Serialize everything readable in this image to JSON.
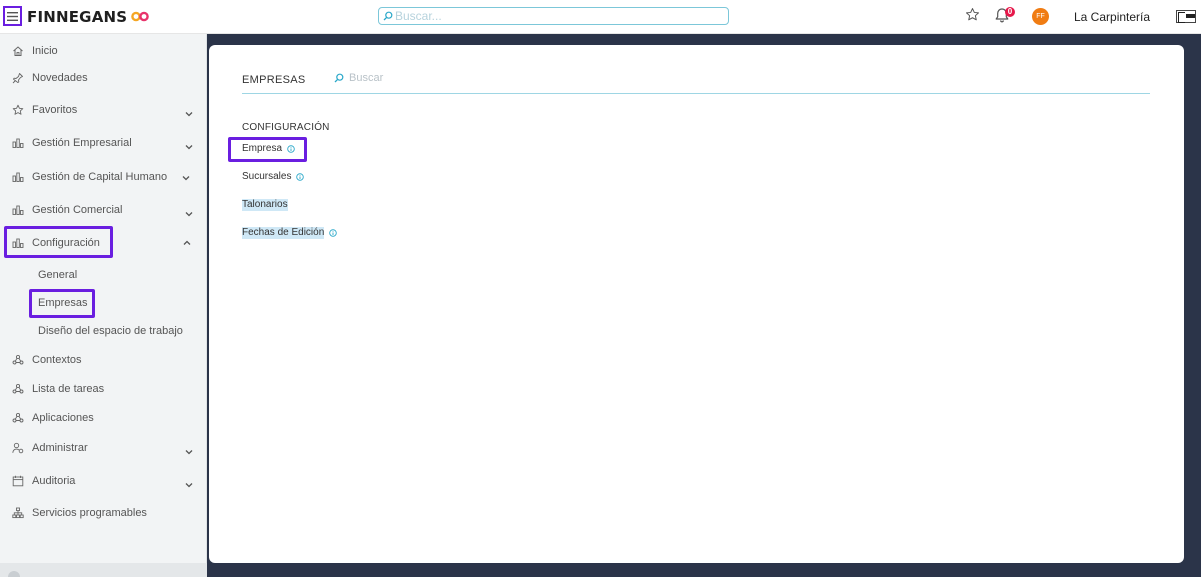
{
  "app": {
    "brand": "FINNEGANS",
    "search_placeholder": "Buscar...",
    "notifications_count": "0",
    "avatar_initials": "FF",
    "company": "La Carpintería",
    "accent": "#6a1ee0"
  },
  "sidebar": {
    "items": [
      {
        "label": "Inicio",
        "icon": "home-icon"
      },
      {
        "label": "Novedades",
        "icon": "pin-icon"
      },
      {
        "label": "Favoritos",
        "icon": "star-icon",
        "expandable": true
      },
      {
        "label": "Gestión Empresarial",
        "icon": "chart-icon",
        "expandable": true
      },
      {
        "label": "Gestión de Capital Humano",
        "icon": "chart-icon",
        "expandable": true
      },
      {
        "label": "Gestión Comercial",
        "icon": "chart-icon",
        "expandable": true
      },
      {
        "label": "Configuración",
        "icon": "chart-icon",
        "expandable": true,
        "expanded": true
      },
      {
        "label": "Contextos",
        "icon": "network-icon"
      },
      {
        "label": "Lista de tareas",
        "icon": "network-icon"
      },
      {
        "label": "Aplicaciones",
        "icon": "network-icon"
      },
      {
        "label": "Administrar",
        "icon": "user-gear-icon",
        "expandable": true
      },
      {
        "label": "Auditoria",
        "icon": "calendar-icon",
        "expandable": true
      },
      {
        "label": "Servicios programables",
        "icon": "sitemap-icon"
      }
    ],
    "config_children": [
      "General",
      "Empresas",
      "Diseño del espacio de trabajo"
    ],
    "active_child": "Empresas"
  },
  "main": {
    "title": "EMPRESAS",
    "search_placeholder": "Buscar",
    "section_heading": "CONFIGURACIÓN",
    "links": [
      {
        "label": "Empresa",
        "info": true,
        "selected": false
      },
      {
        "label": "Sucursales",
        "info": true,
        "selected": false
      },
      {
        "label": "Talonarios",
        "info": false,
        "selected": true
      },
      {
        "label": "Fechas de Edición",
        "info": true,
        "selected": true
      }
    ]
  }
}
